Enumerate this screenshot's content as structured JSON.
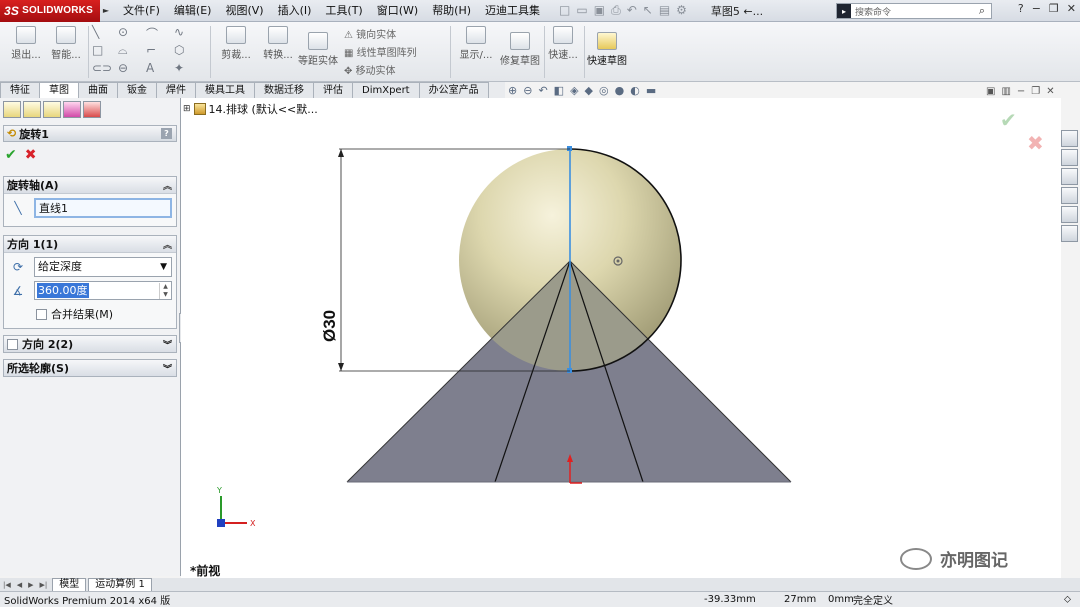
{
  "app": {
    "brand": "SOLIDWORKS",
    "menu": [
      "文件(F)",
      "编辑(E)",
      "视图(V)",
      "插入(I)",
      "工具(T)",
      "窗口(W)",
      "帮助(H)",
      "迈迪工具集"
    ],
    "doc_title": "草图5 ←...",
    "search_placeholder": "搜索命令"
  },
  "ribbon": {
    "exit_sketch": "退出...",
    "smart_dim": "智能...",
    "trim": "剪裁...",
    "convert": "转换...",
    "offset": "等距实体",
    "mirror": "镜向实体",
    "linear_pattern": "线性草图阵列",
    "move": "移动实体",
    "display": "显示/...",
    "repair": "修复草图",
    "quick_snap": "快速...",
    "rapid_sketch": "快速草图"
  },
  "tabs": [
    "特征",
    "草图",
    "曲面",
    "钣金",
    "焊件",
    "模具工具",
    "数据迁移",
    "评估",
    "DimXpert",
    "办公室产品"
  ],
  "active_tab": "草图",
  "property_manager": {
    "title": "旋转1",
    "axis_group": "旋转轴(A)",
    "axis_value": "直线1",
    "dir1_group": "方向 1(1)",
    "end_condition": "给定深度",
    "angle": "360.00度",
    "merge_label": "合并结果(M)",
    "dir2_group": "方向 2(2)",
    "contours_group": "所选轮廓(S)"
  },
  "tree": {
    "item": "14.排球 (默认<<默..."
  },
  "viewport": {
    "dimension_label": "Ø30",
    "view_name": "*前视",
    "axis_y": "Y",
    "axis_x": "X"
  },
  "bottom_tabs": [
    "模型",
    "运动算例 1"
  ],
  "status": {
    "app_version": "SolidWorks Premium 2014 x64 版",
    "x": "-39.33mm",
    "y": "27mm",
    "z": "0mm",
    "state": "完全定义"
  },
  "watermark": "亦明图记"
}
